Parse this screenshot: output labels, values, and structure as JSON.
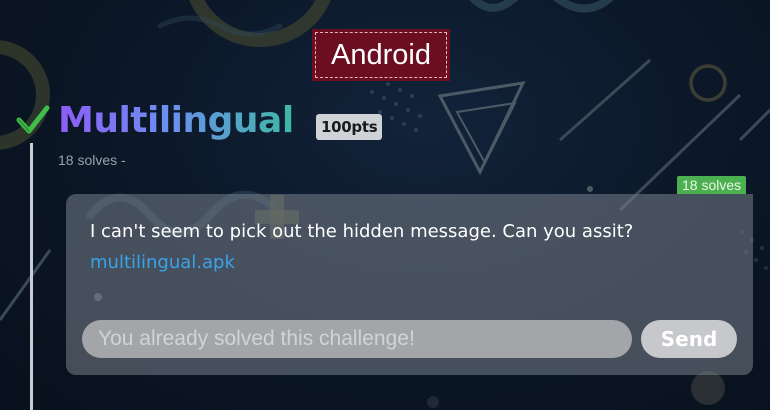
{
  "category": {
    "label": "Android"
  },
  "challenge": {
    "title": "Multilingual",
    "points_label": "100pts",
    "solves_meta": "18 solves -",
    "solves_tag": "18 solves",
    "solved_icon": "check-icon",
    "description": "I can't seem to pick out the hidden message. Can you assit?",
    "attachment": "multilingual.apk"
  },
  "flag_form": {
    "placeholder": "You already solved this challenge!",
    "value": "",
    "submit_label": "Send"
  },
  "colors": {
    "category_badge": "#6b0e1f",
    "solved_check": "#3fbf4a",
    "solves_tag": "#4caf50",
    "link": "#39a3e8",
    "title_gradient_start": "#8d5cf6",
    "title_gradient_end": "#3fb8a4"
  }
}
